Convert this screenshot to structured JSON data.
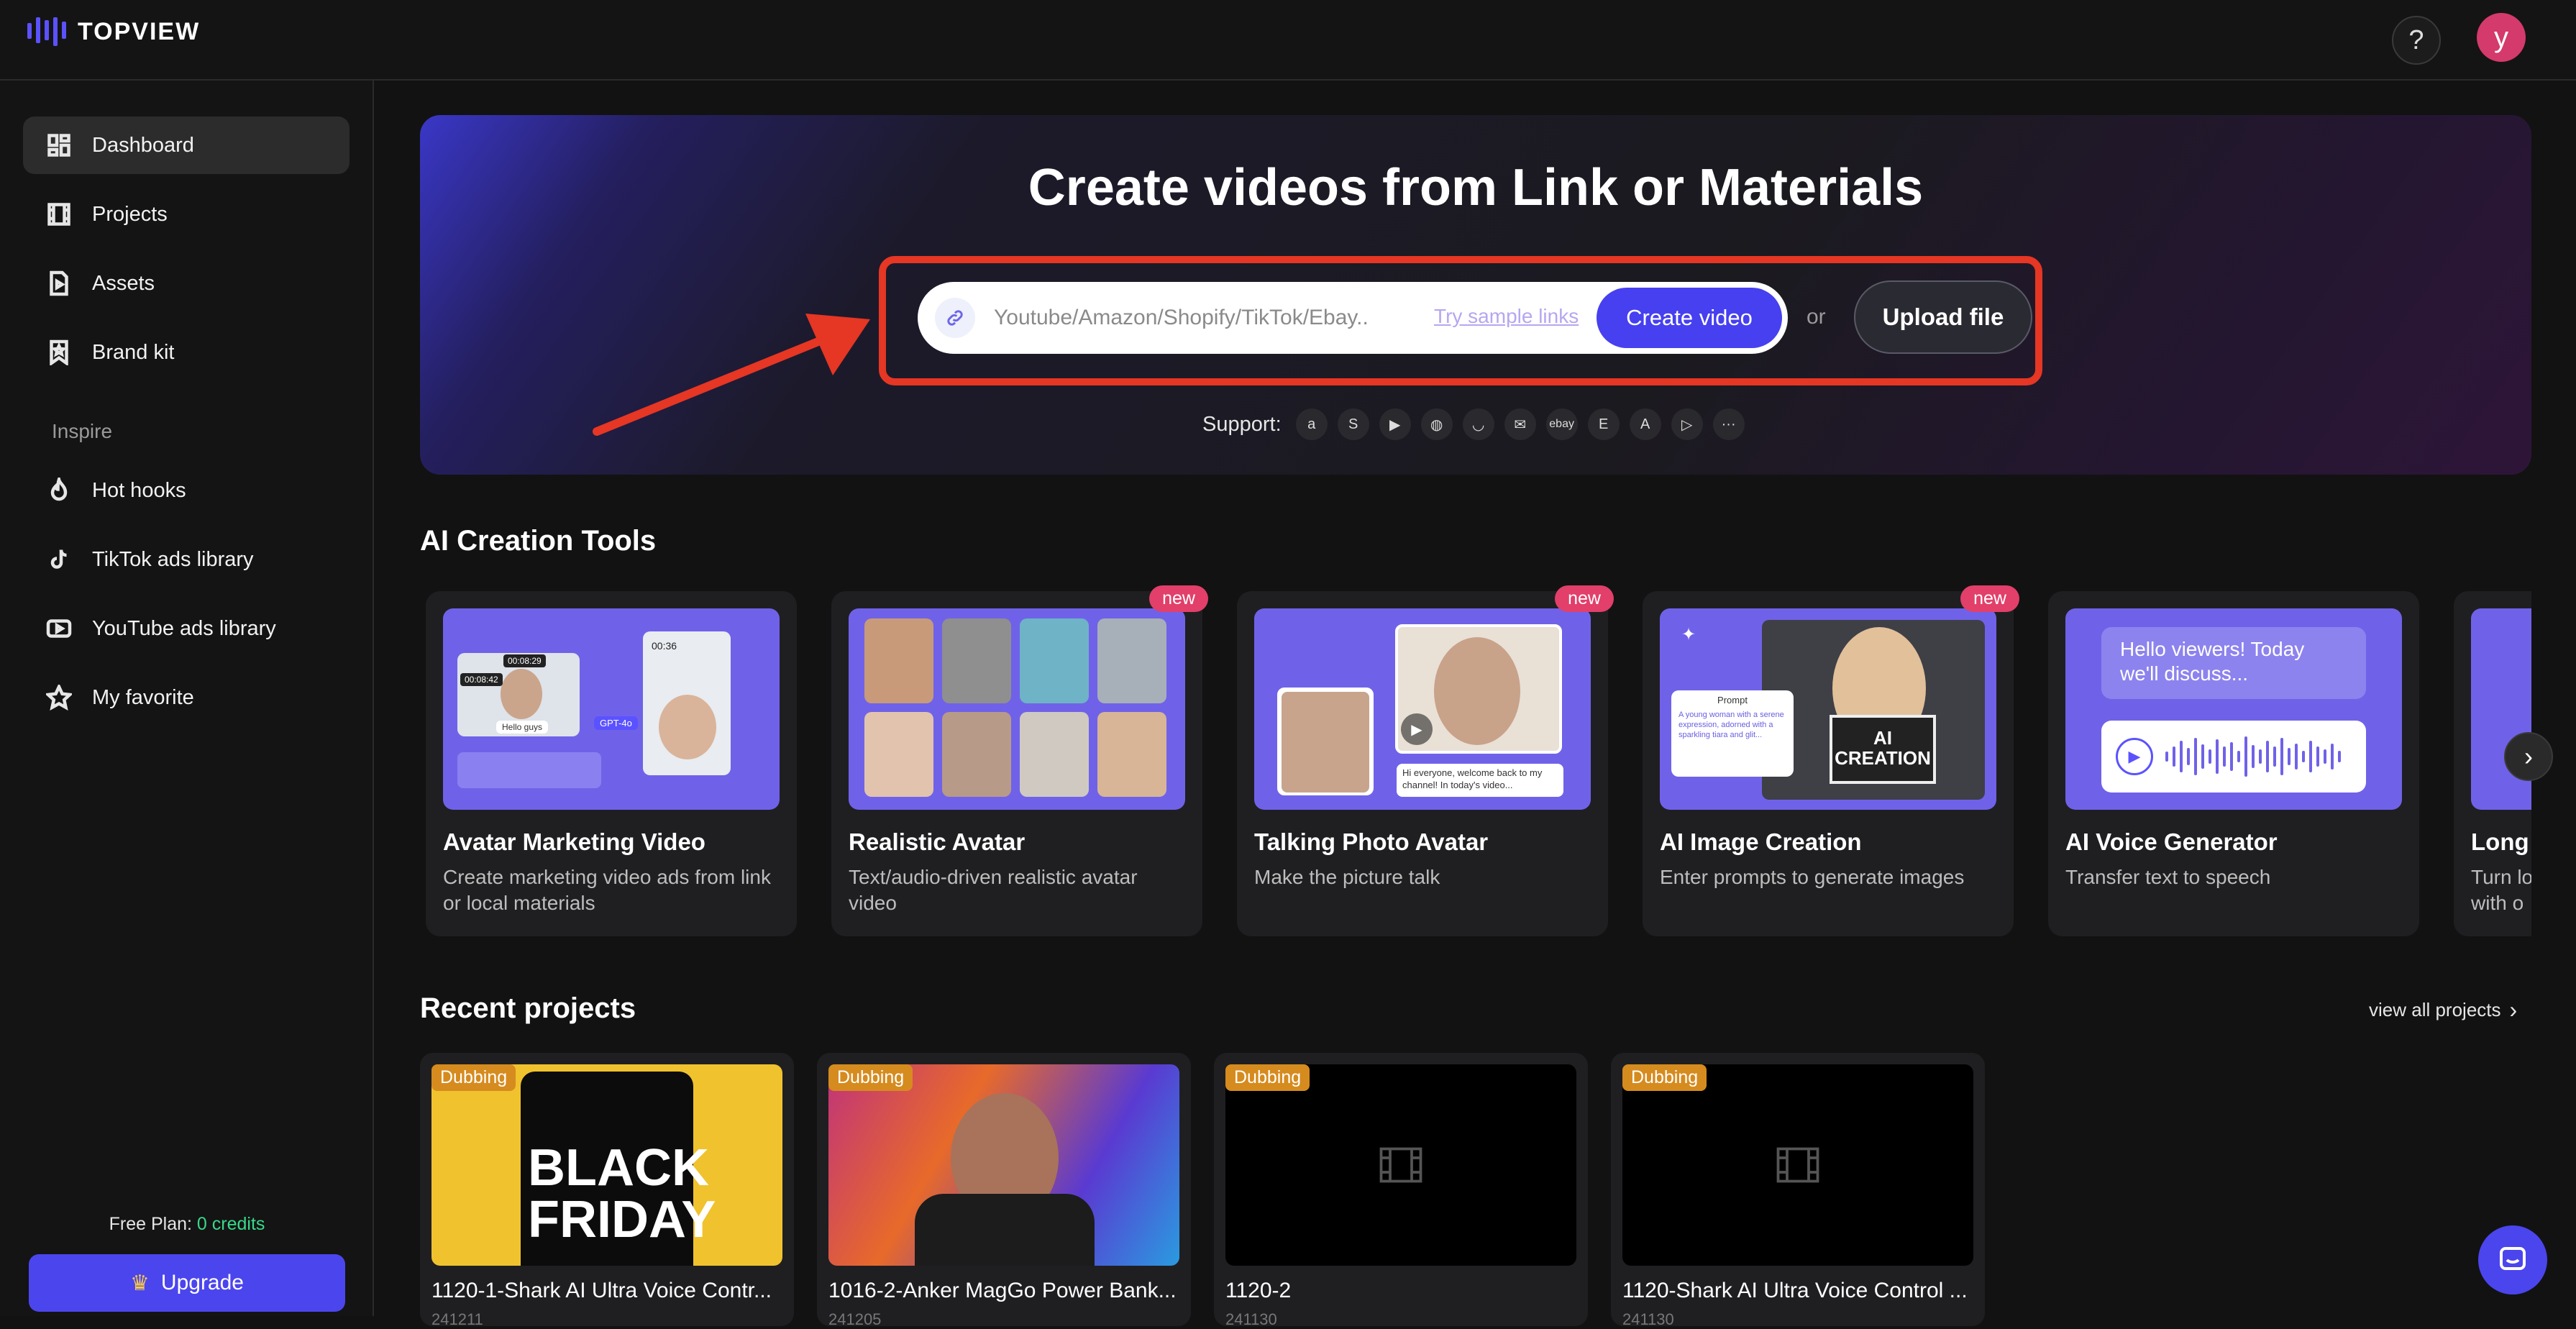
{
  "app": {
    "name": "TOPVIEW",
    "brand_color": "#5b52ff"
  },
  "header": {
    "help_label": "?",
    "avatar_initial": "y"
  },
  "sidebar": {
    "items": [
      {
        "label": "Dashboard",
        "icon": "dashboard-icon",
        "active": true
      },
      {
        "label": "Projects",
        "icon": "film-icon"
      },
      {
        "label": "Assets",
        "icon": "file-play-icon"
      },
      {
        "label": "Brand kit",
        "icon": "bookmark-star-icon"
      }
    ],
    "section_label": "Inspire",
    "inspire_items": [
      {
        "label": "Hot hooks",
        "icon": "flame-icon"
      },
      {
        "label": "TikTok ads library",
        "icon": "tiktok-icon"
      },
      {
        "label": "YouTube ads library",
        "icon": "youtube-icon"
      },
      {
        "label": "My favorite",
        "icon": "star-icon"
      }
    ],
    "plan_label": "Free Plan:",
    "plan_credits": "0 credits",
    "upgrade_label": "Upgrade",
    "upgrade_icon": "crown-icon"
  },
  "hero": {
    "title": "Create videos from Link or Materials",
    "input_placeholder": "Youtube/Amazon/Shopify/TikTok/Ebay..",
    "input_value": "",
    "sample_link_label": "Try sample links",
    "create_label": "Create video",
    "or_label": "or",
    "upload_label": "Upload file",
    "support_label": "Support:",
    "support_icons": [
      "amazon-icon",
      "shopify-icon",
      "youtube-icon",
      "shopify-bag-icon",
      "lazada-icon",
      "gmail-icon",
      "ebay-icon",
      "etsy-icon",
      "app-store-icon",
      "google-play-icon",
      "more-icon"
    ],
    "support_glyphs": [
      "a",
      "S",
      "▶",
      "◍",
      "◡",
      "✉",
      "ebay",
      "E",
      "A",
      "▷",
      "···"
    ],
    "highlight_color": "#e63624"
  },
  "tools": {
    "title": "AI Creation Tools",
    "items": [
      {
        "name": "Avatar Marketing Video",
        "desc": "Create marketing video ads from link or local materials",
        "badge": ""
      },
      {
        "name": "Realistic Avatar",
        "desc": "Text/audio-driven realistic avatar video",
        "badge": "new"
      },
      {
        "name": "Talking Photo Avatar",
        "desc": "Make the picture talk",
        "badge": "new",
        "caption": "Hi everyone, welcome back to my channel! In today's video..."
      },
      {
        "name": "AI Image Creation",
        "desc": "Enter prompts to generate images",
        "badge": "new",
        "prompt_label": "Prompt",
        "prompt_text": "A young woman with a serene expression, adorned with a sparkling tiara and glit...",
        "sign_text": "AI CREATION"
      },
      {
        "name": "AI Voice Generator",
        "desc": "Transfer text to speech",
        "badge": "",
        "bubble_text": "Hello viewers! Today we'll discuss..."
      },
      {
        "name": "Long",
        "desc": "Turn lo with o",
        "badge": ""
      }
    ],
    "thumb1": {
      "time1": "00:08:29",
      "time2": "00:08:42",
      "time3": "00:36",
      "tag": "GPT-4o",
      "bubble": "Hello guys"
    }
  },
  "recent": {
    "title": "Recent projects",
    "view_all_label": "view all projects",
    "items": [
      {
        "badge": "Dubbing",
        "title": "1120-1-Shark AI Ultra Voice Contr...",
        "sub": "241211",
        "thumb_text": "BLACK FRIDAY"
      },
      {
        "badge": "Dubbing",
        "title": "1016-2-Anker MagGo Power Bank...",
        "sub": "241205",
        "thumb_text": ""
      },
      {
        "badge": "Dubbing",
        "title": "1120-2",
        "sub": "241130",
        "thumb_text": ""
      },
      {
        "badge": "Dubbing",
        "title": "1120-Shark AI Ultra Voice Control ...",
        "sub": "241130",
        "thumb_text": ""
      }
    ]
  }
}
